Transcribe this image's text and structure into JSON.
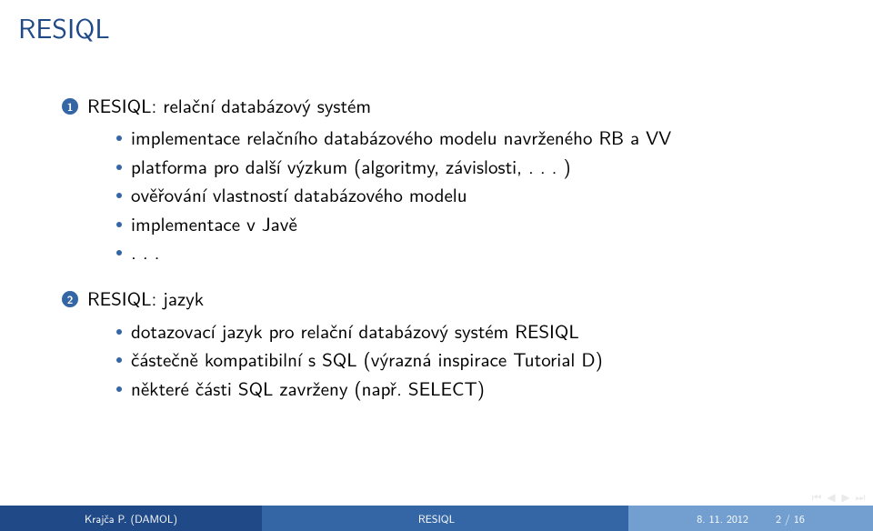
{
  "title": "RESIQL",
  "items": [
    {
      "label": "RESIQL: relační databázový systém",
      "sub": [
        "implementace relačního databázového modelu navrženého RB a VV",
        "platforma pro další výzkum (algoritmy, závislosti, . . . )",
        "ověřování vlastností databázového modelu",
        "implementace v Javě",
        ". . ."
      ]
    },
    {
      "label": "RESIQL: jazyk",
      "sub": [
        "dotazovací jazyk pro relační databázový systém RESIQL",
        "částečně kompatibilní s SQL (výrazná inspirace Tutorial D)",
        "některé části SQL zavrženy (např. SELECT)"
      ]
    }
  ],
  "footer": {
    "author": "Krajča P. (DAMOL)",
    "title": "RESIQL",
    "date": "8. 11. 2012",
    "page": "2 / 16"
  },
  "nav": {
    "first": "⏮",
    "prev": "◀",
    "next": "▶",
    "last": "⏭"
  }
}
